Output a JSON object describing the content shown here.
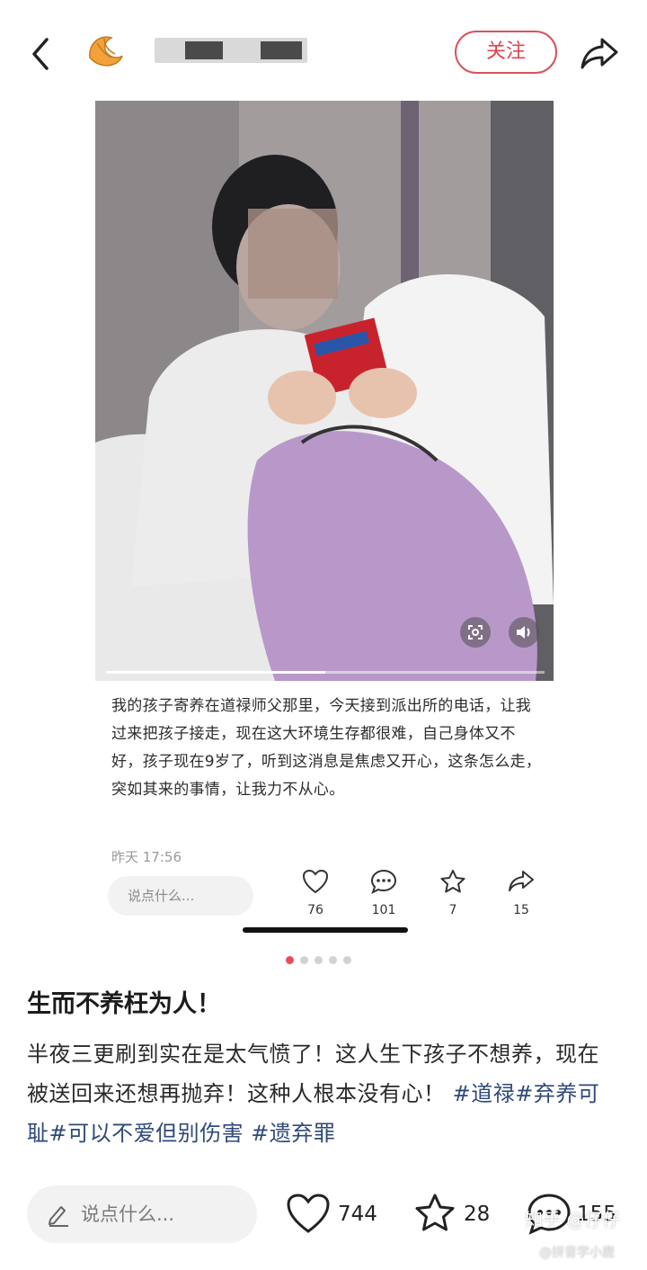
{
  "header": {
    "follow_label": "关注"
  },
  "quoted_post": {
    "text": "我的孩子寄养在道禄师父那里，今天接到派出所的电话，让我过来把孩子接走，现在这大环境生存都很难，自己身体又不好，孩子现在9岁了，听到这消息是焦虑又开心，这条怎么走，突如其来的事情，让我力不从心。",
    "time": "昨天 17:56",
    "comment_placeholder": "说点什么...",
    "like_count": "76",
    "comment_count": "101",
    "star_count": "7",
    "share_count": "15",
    "video_progress": 0.5,
    "slide_index": 1,
    "slide_total": 5
  },
  "post": {
    "title": "生而不养枉为人！",
    "body": "半夜三更刷到实在是太气愤了！这人生下孩子不想养，现在被送回来还想再抛弃！这种人根本没有心！",
    "tags": [
      "#道禄",
      "#弃养可耻",
      "#可以不爱但别伤害",
      "#遗弃罪"
    ]
  },
  "footer": {
    "comment_placeholder": "说点什么...",
    "like_count": "744",
    "star_count": "28",
    "comment_count": "155"
  },
  "watermark": {
    "main": "知乎 @仔仔",
    "sub": "@拼音学小鹿"
  },
  "colors": {
    "accent": "#e0434f",
    "tag": "#2f4a79",
    "active_dot": "#f04a5a"
  },
  "icons": [
    "back-icon",
    "croissant-avatar-icon",
    "share-icon",
    "heart-icon",
    "comment-icon",
    "star-icon",
    "pen-icon",
    "scan-icon",
    "volume-icon"
  ]
}
